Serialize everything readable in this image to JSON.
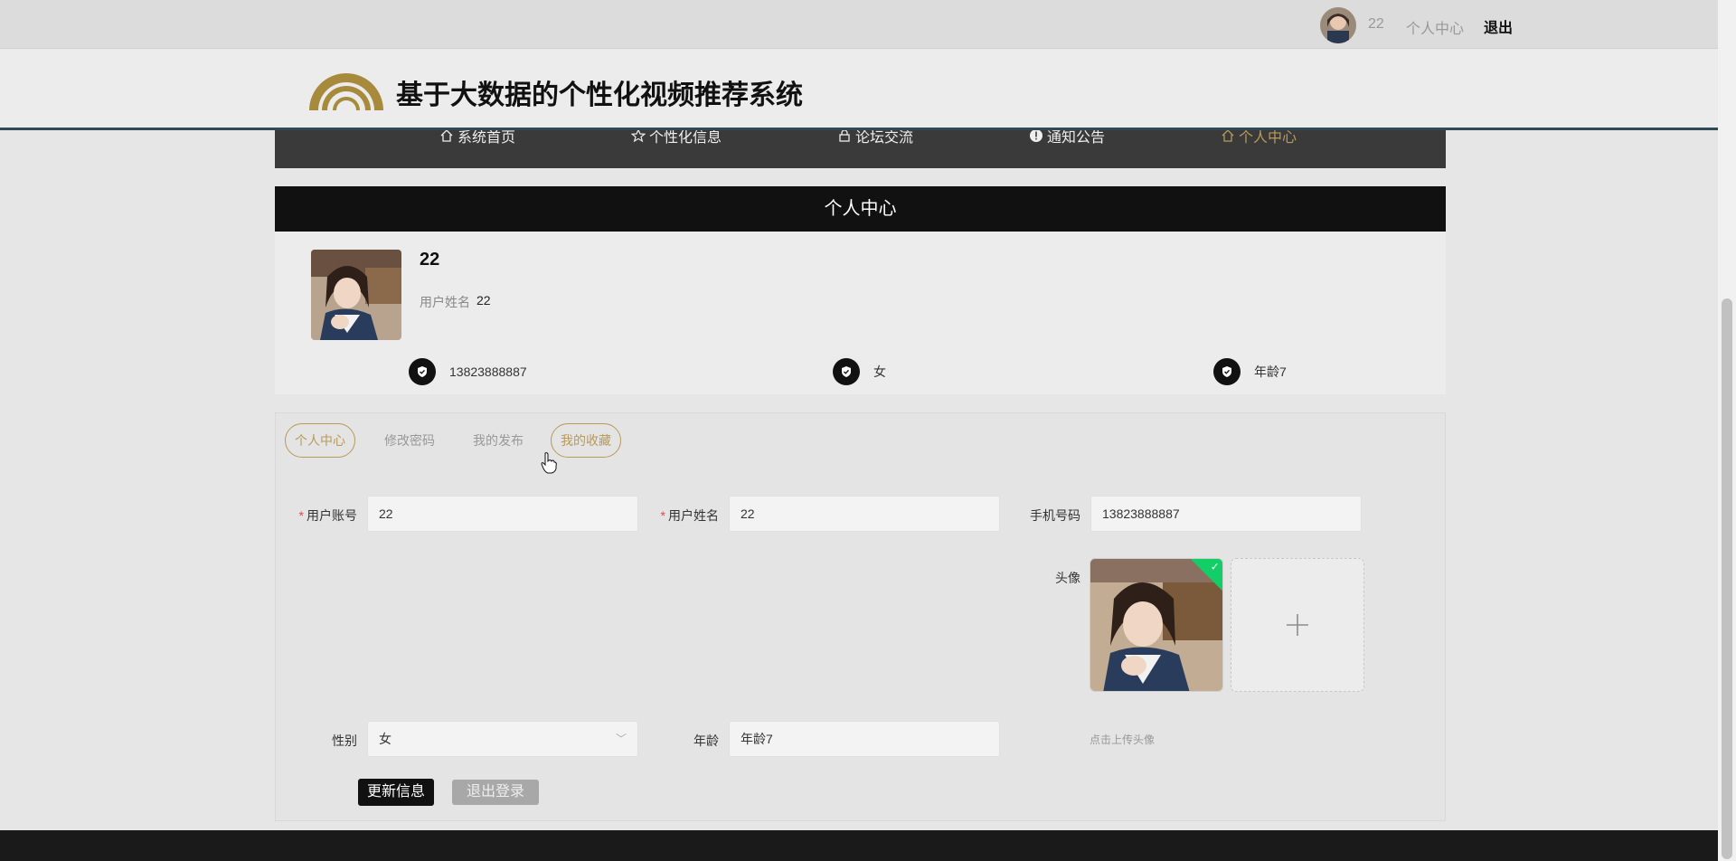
{
  "topbar": {
    "username": "22",
    "center_link": "个人中心",
    "logout": "退出"
  },
  "header": {
    "title": "基于大数据的个性化视频推荐系统"
  },
  "nav": {
    "items": [
      {
        "label": "系统首页",
        "icon": "home-icon"
      },
      {
        "label": "个性化信息",
        "icon": "star-icon"
      },
      {
        "label": "论坛交流",
        "icon": "lock-icon"
      },
      {
        "label": "通知公告",
        "icon": "info-icon"
      },
      {
        "label": "个人中心",
        "icon": "home-icon",
        "active": true
      }
    ]
  },
  "section_title": "个人中心",
  "profile": {
    "name": "22",
    "name_label": "用户姓名",
    "name_value": "22",
    "phone": "13823888887",
    "gender": "女",
    "age": "年龄7"
  },
  "tabs": [
    {
      "label": "个人中心",
      "active": true
    },
    {
      "label": "修改密码"
    },
    {
      "label": "我的发布"
    },
    {
      "label": "我的收藏"
    }
  ],
  "form": {
    "account_label": "用户账号",
    "account_value": "22",
    "name_label": "用户姓名",
    "name_value": "22",
    "phone_label": "手机号码",
    "phone_value": "13823888887",
    "avatar_label": "头像",
    "upload_tip": "点击上传头像",
    "gender_label": "性别",
    "gender_value": "女",
    "age_label": "年龄",
    "age_value": "年龄7"
  },
  "buttons": {
    "update": "更新信息",
    "logout": "退出登录"
  },
  "colors": {
    "accent": "#b89a5a",
    "dark": "#111111",
    "success": "#13ce66"
  }
}
